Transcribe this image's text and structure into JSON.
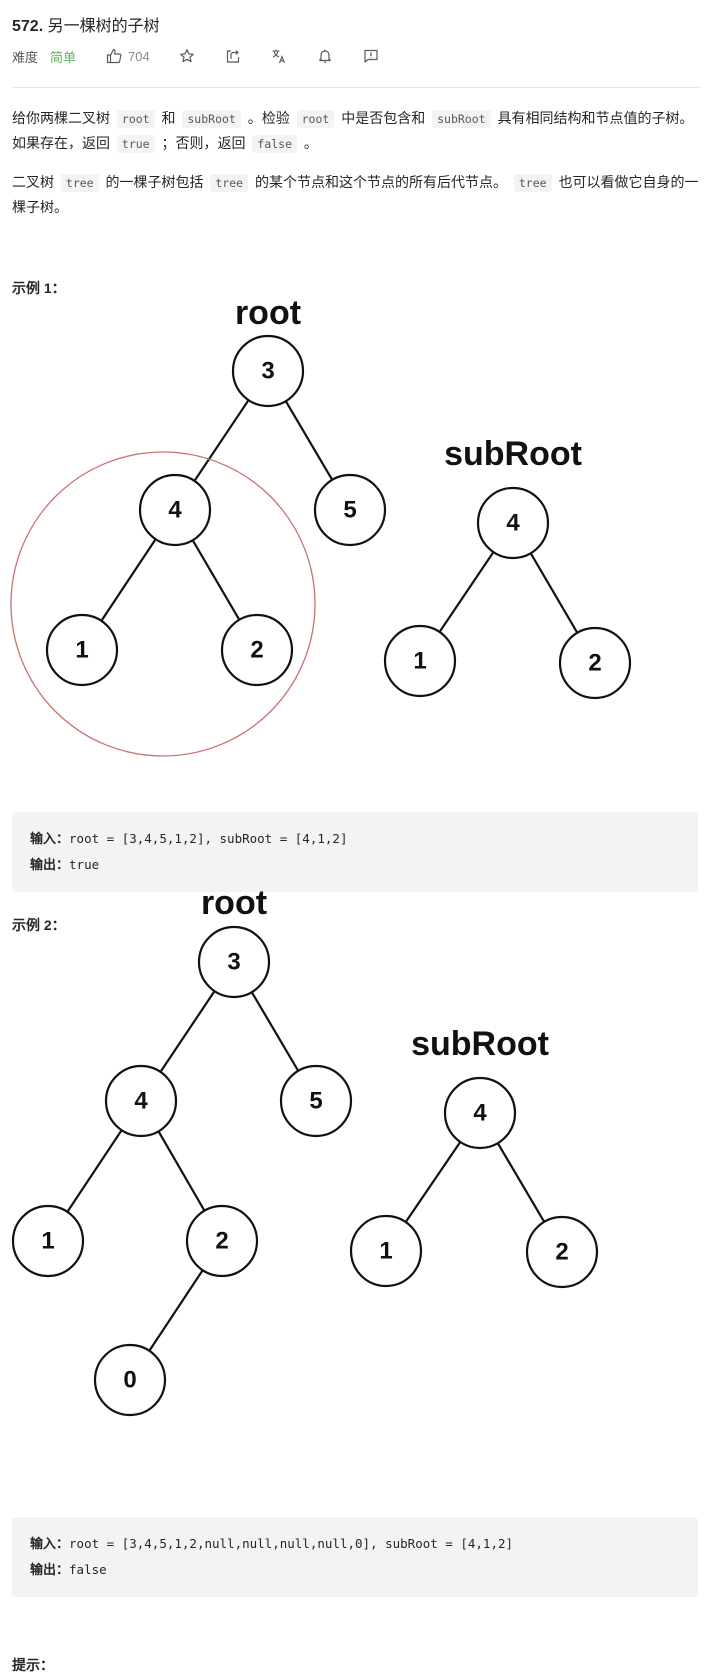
{
  "problem": {
    "number": "572.",
    "title": "另一棵树的子树",
    "difficulty_label": "难度",
    "difficulty": "简单",
    "likes": "704",
    "difficulty_color": "#5cb85c"
  },
  "toolbar_icons": [
    "thumbs-up-icon",
    "star-icon",
    "share-icon",
    "translate-icon",
    "bell-icon",
    "feedback-icon"
  ],
  "description": {
    "p1": [
      {
        "t": "text",
        "v": "给你两棵二叉树 "
      },
      {
        "t": "code",
        "v": "root"
      },
      {
        "t": "text",
        "v": " 和 "
      },
      {
        "t": "code",
        "v": "subRoot"
      },
      {
        "t": "text",
        "v": " 。检验 "
      },
      {
        "t": "code",
        "v": "root"
      },
      {
        "t": "text",
        "v": " 中是否包含和 "
      },
      {
        "t": "code",
        "v": "subRoot"
      },
      {
        "t": "text",
        "v": " 具有相同结构和节点值的子树。如果存在，返回 "
      },
      {
        "t": "code",
        "v": "true"
      },
      {
        "t": "text",
        "v": " ；否则，返回 "
      },
      {
        "t": "code",
        "v": "false"
      },
      {
        "t": "text",
        "v": " 。"
      }
    ],
    "p2": [
      {
        "t": "text",
        "v": "二叉树 "
      },
      {
        "t": "code",
        "v": "tree"
      },
      {
        "t": "text",
        "v": " 的一棵子树包括 "
      },
      {
        "t": "code",
        "v": "tree"
      },
      {
        "t": "text",
        "v": " 的某个节点和这个节点的所有后代节点。 "
      },
      {
        "t": "code",
        "v": "tree"
      },
      {
        "t": "text",
        "v": " 也可以看做它自身的一棵子树。"
      }
    ]
  },
  "examples": [
    {
      "title": "示例 1：",
      "root_label": "root",
      "subroot_label": "subRoot",
      "root_tree": [
        "3",
        "4",
        "5",
        "1",
        "2"
      ],
      "subroot_tree": [
        "4",
        "1",
        "2"
      ],
      "input_label": "输入：",
      "input": "root = [3,4,5,1,2], subRoot = [4,1,2]",
      "output_label": "输出：",
      "output": "true",
      "highlight_color": "#c8736f"
    },
    {
      "title": "示例 2：",
      "root_label": "root",
      "subroot_label": "subRoot",
      "root_tree": [
        "3",
        "4",
        "5",
        "1",
        "2",
        "0"
      ],
      "subroot_tree": [
        "4",
        "1",
        "2"
      ],
      "input_label": "输入：",
      "input": "root = [3,4,5,1,2,null,null,null,null,0], subRoot = [4,1,2]",
      "output_label": "输出：",
      "output": "false"
    }
  ],
  "hint_title": "提示："
}
